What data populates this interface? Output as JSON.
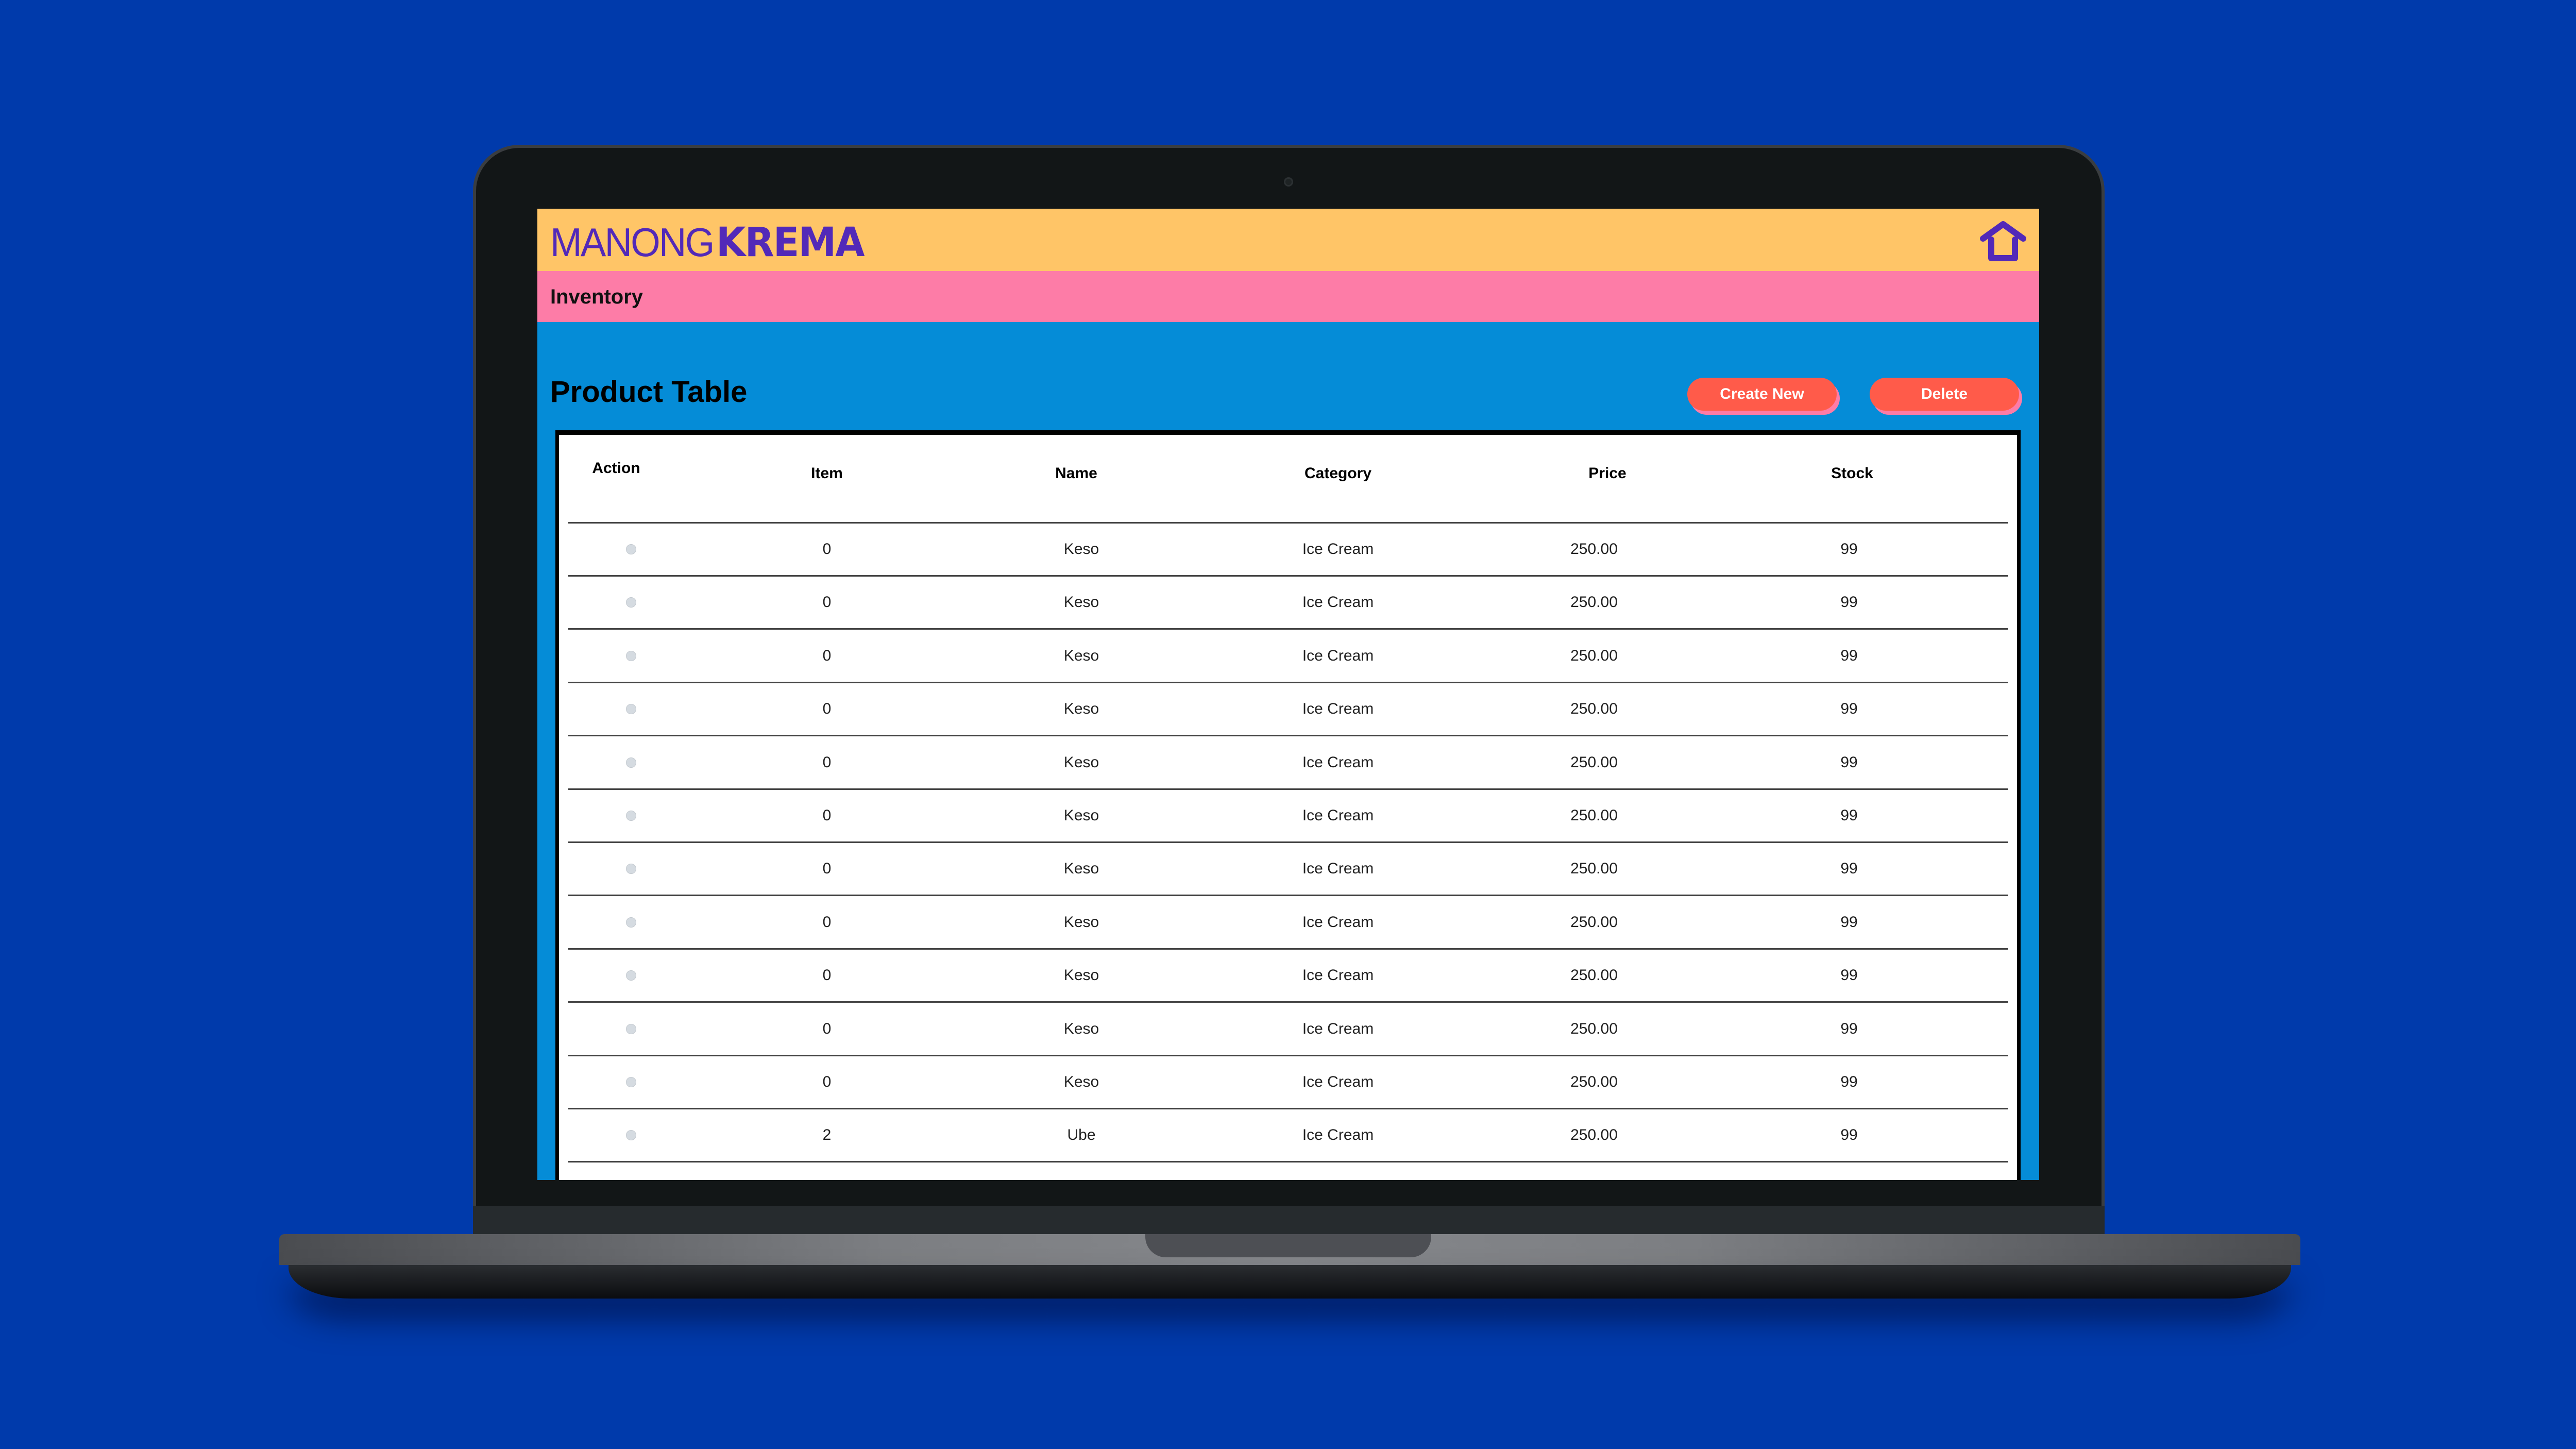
{
  "app": {
    "logo_light": "MANONG",
    "logo_bold": "KREMA",
    "home_icon": "home-icon"
  },
  "nav": {
    "section": "Inventory"
  },
  "main": {
    "title": "Product Table",
    "create_label": "Create New",
    "delete_label": "Delete"
  },
  "colors": {
    "header": "#ffc567",
    "nav": "#fd7ca7",
    "content": "#058cd7",
    "button": "#ff5b4a",
    "brand": "#5229b8"
  },
  "table": {
    "columns": [
      "Action",
      "Item",
      "Name",
      "Category",
      "Price",
      "Stock"
    ],
    "rows": [
      {
        "item": "0",
        "name": "Keso",
        "category": "Ice Cream",
        "price": "250.00",
        "stock": "99"
      },
      {
        "item": "0",
        "name": "Keso",
        "category": "Ice Cream",
        "price": "250.00",
        "stock": "99"
      },
      {
        "item": "0",
        "name": "Keso",
        "category": "Ice Cream",
        "price": "250.00",
        "stock": "99"
      },
      {
        "item": "0",
        "name": "Keso",
        "category": "Ice Cream",
        "price": "250.00",
        "stock": "99"
      },
      {
        "item": "0",
        "name": "Keso",
        "category": "Ice Cream",
        "price": "250.00",
        "stock": "99"
      },
      {
        "item": "0",
        "name": "Keso",
        "category": "Ice Cream",
        "price": "250.00",
        "stock": "99"
      },
      {
        "item": "0",
        "name": "Keso",
        "category": "Ice Cream",
        "price": "250.00",
        "stock": "99"
      },
      {
        "item": "0",
        "name": "Keso",
        "category": "Ice Cream",
        "price": "250.00",
        "stock": "99"
      },
      {
        "item": "0",
        "name": "Keso",
        "category": "Ice Cream",
        "price": "250.00",
        "stock": "99"
      },
      {
        "item": "0",
        "name": "Keso",
        "category": "Ice Cream",
        "price": "250.00",
        "stock": "99"
      },
      {
        "item": "0",
        "name": "Keso",
        "category": "Ice Cream",
        "price": "250.00",
        "stock": "99"
      },
      {
        "item": "2",
        "name": "Ube",
        "category": "Ice Cream",
        "price": "250.00",
        "stock": "99"
      }
    ]
  }
}
